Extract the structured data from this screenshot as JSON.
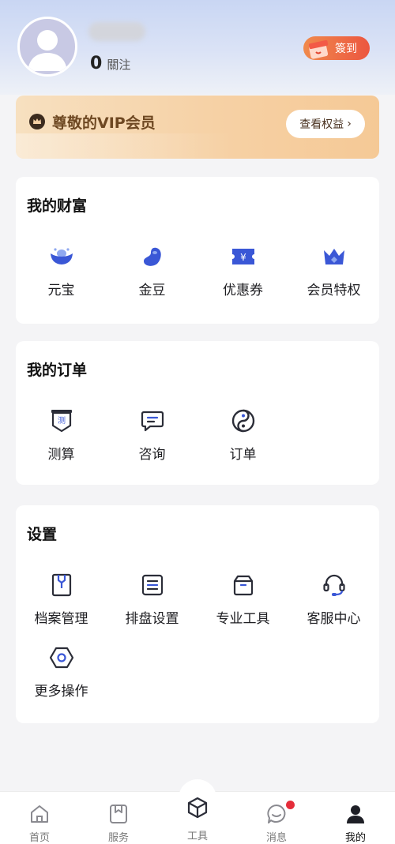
{
  "profile": {
    "follow_count": "0",
    "follow_label": "關注",
    "checkin_label": "簽到"
  },
  "vip": {
    "title": "尊敬的VIP会员",
    "button_label": "查看权益",
    "button_chevron": "›"
  },
  "wealth": {
    "title": "我的财富",
    "items": [
      {
        "label": "元宝",
        "icon": "ingot-icon"
      },
      {
        "label": "金豆",
        "icon": "bean-icon"
      },
      {
        "label": "优惠券",
        "icon": "coupon-icon"
      },
      {
        "label": "会员特权",
        "icon": "crown-icon"
      }
    ]
  },
  "orders": {
    "title": "我的订单",
    "items": [
      {
        "label": "测算",
        "icon": "divination-icon",
        "glyph": "测"
      },
      {
        "label": "咨询",
        "icon": "chat-icon"
      },
      {
        "label": "订单",
        "icon": "yin-yang-icon"
      }
    ]
  },
  "settings": {
    "title": "设置",
    "items": [
      {
        "label": "档案管理",
        "icon": "archive-icon"
      },
      {
        "label": "排盘设置",
        "icon": "list-icon"
      },
      {
        "label": "专业工具",
        "icon": "box-icon"
      },
      {
        "label": "客服中心",
        "icon": "headset-icon"
      },
      {
        "label": "更多操作",
        "icon": "hexagon-icon"
      }
    ]
  },
  "tabbar": {
    "tabs": [
      {
        "label": "首页",
        "icon": "home-icon"
      },
      {
        "label": "服务",
        "icon": "bookmark-icon"
      },
      {
        "label": "工具",
        "icon": "cube-icon"
      },
      {
        "label": "消息",
        "icon": "message-icon"
      },
      {
        "label": "我的",
        "icon": "user-icon"
      }
    ],
    "active": "我的"
  },
  "colors": {
    "accent_blue": "#3a57d6",
    "vip_text": "#6e4822",
    "checkin": "#ec5640",
    "badge": "#e52d3a"
  }
}
